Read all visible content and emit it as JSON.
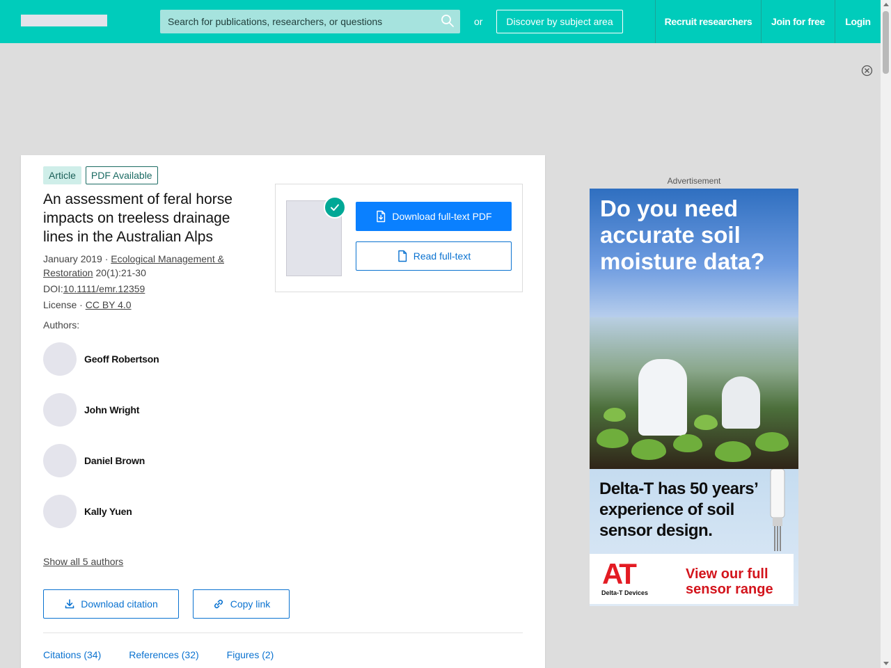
{
  "header": {
    "search_placeholder": "Search for publications, researchers, or questions",
    "or_label": "or",
    "discover_label": "Discover by subject area",
    "nav": [
      "Recruit researchers",
      "Join for free",
      "Login"
    ]
  },
  "article": {
    "type_badge": "Article",
    "pdf_badge": "PDF Available",
    "title": "An assessment of feral horse impacts on treeless drainage lines in the Australian Alps",
    "date": "January 2019 · ",
    "journal": "Ecological Management & Restoration",
    "issue": " 20(1):21-30",
    "doi_label": "DOI:",
    "doi": "10.1111/emr.12359",
    "license_label": "License · ",
    "license": "CC BY 4.0",
    "authors_label": "Authors:",
    "authors": [
      "Geoff Robertson",
      "John Wright",
      "Daniel Brown",
      "Kally Yuen"
    ],
    "show_all": "Show all 5 authors",
    "download_citation": "Download citation",
    "copy_link": "Copy link",
    "tabs": [
      "Citations (34)",
      "References (32)",
      "Figures (2)"
    ]
  },
  "pdf_panel": {
    "download_label": "Download full-text PDF",
    "read_label": "Read full-text"
  },
  "ad": {
    "label": "Advertisement",
    "headline": "Do you need accurate soil moisture data?",
    "subline": "Delta-T has 50 years’ experience of soil sensor design.",
    "logo": "AT",
    "logo_sub": "Delta-T Devices",
    "cta": "View our full sensor range"
  },
  "colors": {
    "brand": "#00ccbb",
    "primary_button": "#0a80ff",
    "link_blue": "#0a72d0",
    "ad_red": "#e31b23"
  },
  "icons": [
    "search-icon",
    "close-circle-icon",
    "check-icon",
    "pdf-download-icon",
    "document-icon",
    "download-icon",
    "link-icon"
  ]
}
